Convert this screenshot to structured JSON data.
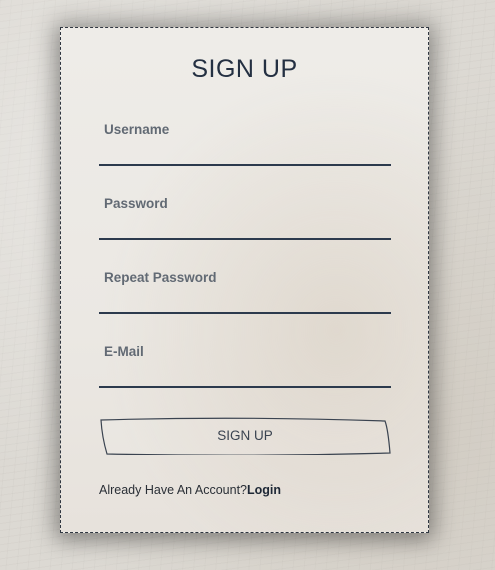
{
  "form": {
    "title": "SIGN UP",
    "fields": [
      {
        "label": "Username"
      },
      {
        "label": "Password"
      },
      {
        "label": "Repeat Password"
      },
      {
        "label": "E-Mail"
      }
    ],
    "submit_label": "SIGN UP",
    "footer_text": "Already Have An Account?",
    "login_link": "Login"
  },
  "colors": {
    "ink": "#243042",
    "underline": "#2c3a4d",
    "label": "#626a74",
    "card": "#eeece8"
  }
}
